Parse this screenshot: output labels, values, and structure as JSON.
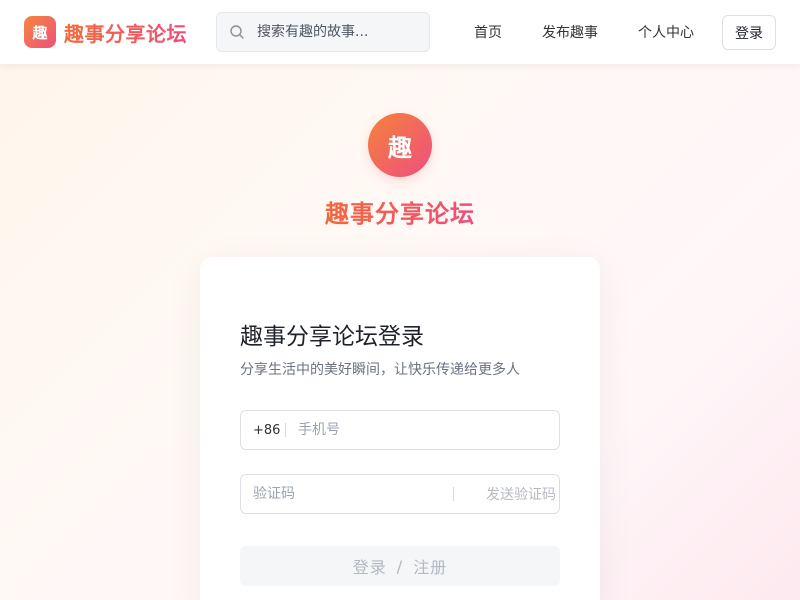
{
  "header": {
    "logo_char": "趣",
    "brand_name": "趣事分享论坛",
    "search_placeholder": "搜索有趣的故事...",
    "nav": {
      "home": "首页",
      "publish": "发布趣事",
      "user_center": "个人中心"
    },
    "login_label": "登录"
  },
  "hero": {
    "logo_char": "趣",
    "title": "趣事分享论坛"
  },
  "login_card": {
    "title": "趣事分享论坛登录",
    "subtitle": "分享生活中的美好瞬间，让快乐传递给更多人",
    "phone_prefix": "+86",
    "phone_placeholder": "手机号",
    "code_placeholder": "验证码",
    "send_code_label": "发送验证码",
    "submit_login": "登录",
    "submit_separator": "/",
    "submit_register": "注册"
  },
  "icons": {
    "search": "search-icon"
  },
  "colors": {
    "brand_orange": "#f4863e",
    "brand_pink": "#ee4f80"
  }
}
